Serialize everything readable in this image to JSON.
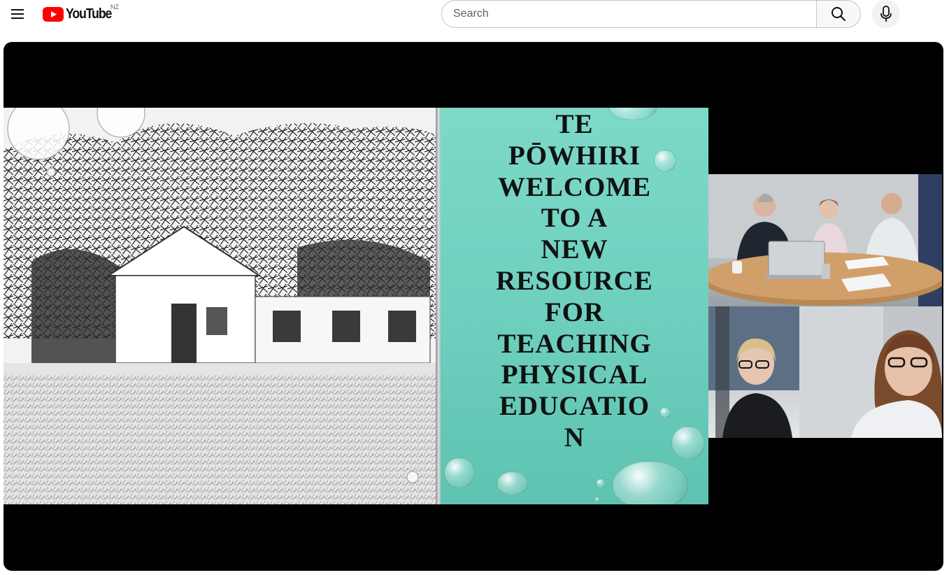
{
  "masthead": {
    "logo_text": "YouTube",
    "country_code": "NZ",
    "search_placeholder": "Search",
    "search_value": ""
  },
  "icons": {
    "menu": "hamburger-menu-icon",
    "logo": "youtube-play-icon",
    "search": "magnifier-icon",
    "mic": "microphone-icon"
  },
  "colors": {
    "brand_red": "#ff0000",
    "slide_teal": "#6fd0bf",
    "player_bg": "#000000"
  },
  "video": {
    "slide_title_lines": [
      "TE",
      "PŌWHIRI",
      "WELCOME",
      "TO A",
      "NEW",
      "RESOURCE",
      "FOR",
      "TEACHING",
      "PHYSICAL",
      "EDUCATIO",
      "N"
    ]
  }
}
